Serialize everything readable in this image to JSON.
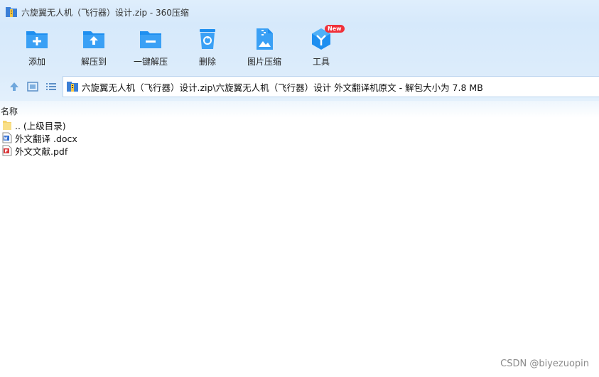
{
  "window": {
    "title": "六旋翼无人机（飞行器）设计.zip - 360压缩"
  },
  "toolbar": {
    "items": [
      {
        "label": "添加",
        "icon": "add-folder-icon"
      },
      {
        "label": "解压到",
        "icon": "extract-to-icon"
      },
      {
        "label": "一键解压",
        "icon": "one-click-extract-icon"
      },
      {
        "label": "删除",
        "icon": "recycle-bin-icon"
      },
      {
        "label": "图片压缩",
        "icon": "image-compress-icon"
      },
      {
        "label": "工具",
        "icon": "tools-cube-icon",
        "badge": "New"
      }
    ]
  },
  "navbar": {
    "path": "六旋翼无人机（飞行器）设计.zip\\六旋翼无人机（飞行器）设计 外文翻译机原文 - 解包大小为 7.8 MB"
  },
  "list": {
    "column_name": "名称",
    "rows": [
      {
        "name": ".. (上级目录)",
        "icon": "parent-folder-icon"
      },
      {
        "name": "外文翻译 .docx",
        "icon": "word-doc-icon"
      },
      {
        "name": "外文文献.pdf",
        "icon": "pdf-file-icon"
      }
    ]
  },
  "watermark": "CSDN @biyezuopin",
  "colors": {
    "accent_blue": "#1e8ff0",
    "badge_red": "#f0313a",
    "folder_yellow": "#f5d36b"
  }
}
